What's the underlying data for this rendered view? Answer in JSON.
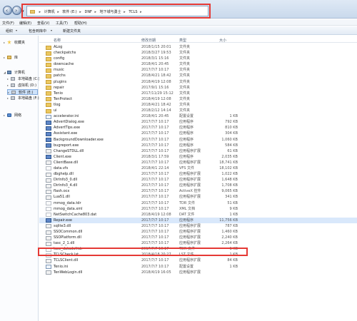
{
  "address": {
    "crumbs": [
      "计算机",
      "软件 (E:)",
      "DNF",
      "地下城与勇士",
      "TCLS"
    ]
  },
  "menu": [
    "文件(F)",
    "编辑(E)",
    "查看(V)",
    "工具(T)",
    "帮助(H)"
  ],
  "toolbar": {
    "organize": "组织",
    "include": "包含到库中",
    "new_folder": "新建文件夹"
  },
  "nav": {
    "favorites": "收藏夹",
    "library": "库",
    "computer": "计算机",
    "drives": [
      "本地磁盘 (C:)",
      "虚拟机 (D:)",
      "软件 (E:)",
      "本地磁盘 (F:)"
    ],
    "network": "网络"
  },
  "columns": {
    "name": "名称",
    "date": "修改日期",
    "type": "类型",
    "size": "大小"
  },
  "files": [
    {
      "name": "ALog",
      "date": "2018/1/15 20:01",
      "type": "文件夹",
      "size": "",
      "kind": "folder"
    },
    {
      "name": "checkpatchs",
      "date": "2018/3/27 19:53",
      "type": "文件夹",
      "size": "",
      "kind": "folder"
    },
    {
      "name": "config",
      "date": "2018/3/1 15:16",
      "type": "文件夹",
      "size": "",
      "kind": "folder"
    },
    {
      "name": "downcache",
      "date": "2018/4/1 20:45",
      "type": "文件夹",
      "size": "",
      "kind": "folder"
    },
    {
      "name": "music",
      "date": "2017/7/7 10:17",
      "type": "文件夹",
      "size": "",
      "kind": "folder"
    },
    {
      "name": "patchs",
      "date": "2018/4/21 18:42",
      "type": "文件夹",
      "size": "",
      "kind": "folder"
    },
    {
      "name": "plugins",
      "date": "2018/4/19 12:08",
      "type": "文件夹",
      "size": "",
      "kind": "folder"
    },
    {
      "name": "repair",
      "date": "2017/9/1 15:16",
      "type": "文件夹",
      "size": "",
      "kind": "folder"
    },
    {
      "name": "Tenio",
      "date": "2017/11/29 15:12",
      "type": "文件夹",
      "size": "",
      "kind": "folder"
    },
    {
      "name": "TenProtect",
      "date": "2018/4/19 12:08",
      "type": "文件夹",
      "size": "",
      "kind": "folder"
    },
    {
      "name": "tlog",
      "date": "2018/4/21 18:42",
      "type": "文件夹",
      "size": "",
      "kind": "folder"
    },
    {
      "name": "ui",
      "date": "2018/2/12 14:14",
      "type": "文件夹",
      "size": "",
      "kind": "folder"
    },
    {
      "name": "accelerator.ini",
      "date": "2018/4/1 20:45",
      "type": "配置设置",
      "size": "1 KB",
      "kind": "cfg"
    },
    {
      "name": "AdvertDialog.exe",
      "date": "2017/7/7 10:17",
      "type": "应用程序",
      "size": "792 KB",
      "kind": "app"
    },
    {
      "name": "AdvertTips.exe",
      "date": "2017/7/7 10:17",
      "type": "应用程序",
      "size": "810 KB",
      "kind": "app"
    },
    {
      "name": "Assistant.exe",
      "date": "2017/7/7 10:17",
      "type": "应用程序",
      "size": "304 KB",
      "kind": "app"
    },
    {
      "name": "BackgroundDownloader.exe",
      "date": "2017/7/7 10:17",
      "type": "应用程序",
      "size": "1,060 KB",
      "kind": "app"
    },
    {
      "name": "bugreport.exe",
      "date": "2017/7/7 10:17",
      "type": "应用程序",
      "size": "584 KB",
      "kind": "app"
    },
    {
      "name": "ChangeSTDLL.dll",
      "date": "2017/7/7 10:17",
      "type": "应用程序扩展",
      "size": "61 KB",
      "kind": "dll"
    },
    {
      "name": "Client.exe",
      "date": "2018/3/1 17:59",
      "type": "应用程序",
      "size": "2,035 KB",
      "kind": "app"
    },
    {
      "name": "ClientBase.dll",
      "date": "2017/7/7 10:17",
      "type": "应用程序扩展",
      "size": "18,741 KB",
      "kind": "dll"
    },
    {
      "name": "data.vfs",
      "date": "2018/4/1 22:14",
      "type": "VFS 文件",
      "size": "18,102 KB",
      "kind": "file"
    },
    {
      "name": "dbghelp.dll",
      "date": "2017/7/7 10:17",
      "type": "应用程序扩展",
      "size": "1,022 KB",
      "kind": "dll"
    },
    {
      "name": "DirInfo3_0.dll",
      "date": "2017/7/7 10:17",
      "type": "应用程序扩展",
      "size": "1,648 KB",
      "kind": "dll"
    },
    {
      "name": "DirInfo3_4.dll",
      "date": "2017/7/7 10:17",
      "type": "应用程序扩展",
      "size": "1,708 KB",
      "kind": "dll"
    },
    {
      "name": "flash.ocx",
      "date": "2017/7/7 10:17",
      "type": "ActiveX 控件",
      "size": "9,065 KB",
      "kind": "dll"
    },
    {
      "name": "Lua51.dll",
      "date": "2017/7/7 10:17",
      "type": "应用程序扩展",
      "size": "341 KB",
      "kind": "dll"
    },
    {
      "name": "mmog_data.tdr",
      "date": "2017/7/7 10:17",
      "type": "TDR 文件",
      "size": "51 KB",
      "kind": "file"
    },
    {
      "name": "mmog_data.xml",
      "date": "2017/7/7 10:17",
      "type": "XML 文档",
      "size": "9 KB",
      "kind": "file"
    },
    {
      "name": "NetSwitchCache803.dat",
      "date": "2018/4/19 12:08",
      "type": "DAT 文件",
      "size": "1 KB",
      "kind": "file"
    },
    {
      "name": "Repair.exe",
      "date": "2017/7/7 10:17",
      "type": "应用程序",
      "size": "11,756 KB",
      "kind": "app"
    },
    {
      "name": "sqlite3.dll",
      "date": "2017/7/7 10:17",
      "type": "应用程序扩展",
      "size": "787 KB",
      "kind": "dll"
    },
    {
      "name": "SSOCommon.dll",
      "date": "2017/7/7 10:17",
      "type": "应用程序扩展",
      "size": "1,460 KB",
      "kind": "dll"
    },
    {
      "name": "SSOPlatform.dll",
      "date": "2017/7/7 10:17",
      "type": "应用程序扩展",
      "size": "2,240 KB",
      "kind": "dll"
    },
    {
      "name": "tasc_2_1.dll",
      "date": "2017/7/7 10:17",
      "type": "应用程序扩展",
      "size": "2,264 KB",
      "kind": "dll"
    },
    {
      "name": "tasc_datadef.tdr",
      "date": "2017/7/7 10:17",
      "type": "TDR 文件",
      "size": "1 KB",
      "kind": "file"
    },
    {
      "name": "TCLSCheck.lst",
      "date": "2018/4/18 20:27",
      "type": "LST 文件",
      "size": "1 KB",
      "kind": "file"
    },
    {
      "name": "TCLSClient.dll",
      "date": "2017/7/7 10:17",
      "type": "应用程序扩展",
      "size": "84 KB",
      "kind": "dll"
    },
    {
      "name": "Tenio.ini",
      "date": "2017/7/7 10:17",
      "type": "配置设置",
      "size": "1 KB",
      "kind": "cfg"
    },
    {
      "name": "TenWebLogin.dll",
      "date": "2018/4/19 16:05",
      "type": "应用程序扩展",
      "size": "",
      "kind": "dll"
    }
  ]
}
